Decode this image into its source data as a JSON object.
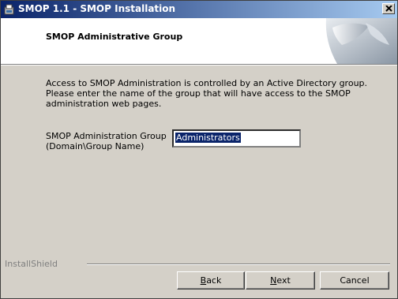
{
  "window": {
    "title": "SMOP 1.1 - SMOP Installation"
  },
  "banner": {
    "title": "SMOP Administrative Group"
  },
  "description": {
    "lines": [
      "Access to SMOP Administration is controlled by an Active Directory group.",
      "Please enter the name of the group that will have access to the SMOP",
      "administration web pages."
    ]
  },
  "group_field": {
    "label_line1": "SMOP Administration Group",
    "label_line2": "(Domain\\Group Name)",
    "value": "Administrators"
  },
  "footer": {
    "brand": "InstallShield"
  },
  "buttons": {
    "back_accel": "B",
    "back_rest": "ack",
    "next_accel": "N",
    "next_rest": "ext",
    "cancel": "Cancel"
  },
  "colors": {
    "titlebar_start": "#0a246a",
    "titlebar_end": "#a6caf0",
    "dialog_bg": "#d4d0c8",
    "selection": "#0a246a"
  },
  "icons": {
    "app": "installer-icon",
    "close": "close-icon",
    "banner": "page-curl-art"
  }
}
